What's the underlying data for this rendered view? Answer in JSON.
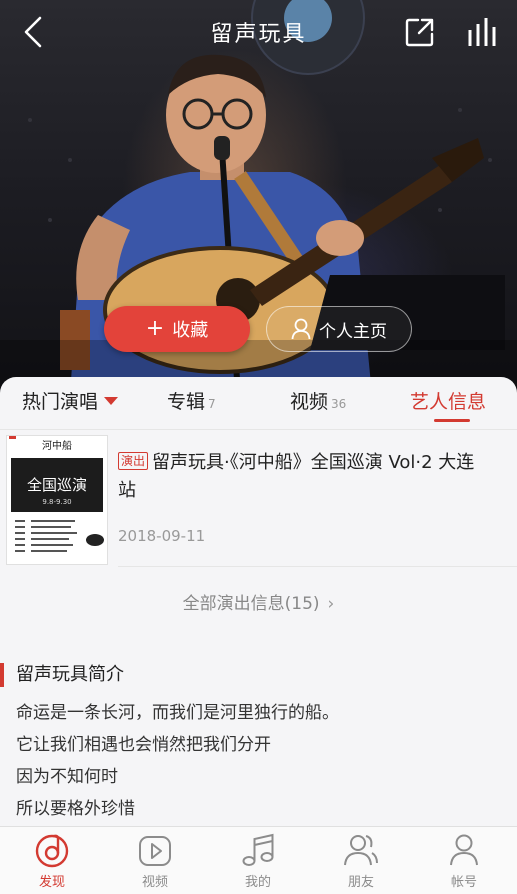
{
  "header": {
    "title": "留声玩具",
    "back_icon": "chevron-left-icon",
    "share_icon": "share-icon",
    "playing_icon": "now-playing-bars-icon"
  },
  "hero": {
    "collect_label": "收藏",
    "collect_icon": "plus-icon",
    "homepage_label": "个人主页",
    "homepage_icon": "user-icon"
  },
  "tabs": [
    {
      "label": "热门演唱",
      "count": ""
    },
    {
      "label": "专辑",
      "count": "7"
    },
    {
      "label": "视频",
      "count": "36"
    },
    {
      "label": "艺人信息",
      "count": ""
    }
  ],
  "concert": {
    "tag": "演出",
    "title": "留声玩具·《河中船》全国巡演 Vol·2 大连站",
    "date": "2018-09-11",
    "poster": {
      "heading": "河中船",
      "banner": "全国巡演",
      "sub": "9.8-9.30"
    }
  },
  "all_concerts": {
    "label": "全部演出信息(15)"
  },
  "intro": {
    "title": "留声玩具简介",
    "lines": [
      "命运是一条长河，而我们是河里独行的船。",
      "它让我们相遇也会悄然把我们分开",
      "因为不知何时",
      "所以要格外珍惜"
    ]
  },
  "bottom_nav": [
    {
      "label": "发现",
      "icon": "discover-icon",
      "active": true
    },
    {
      "label": "视频",
      "icon": "video-play-icon",
      "active": false
    },
    {
      "label": "我的",
      "icon": "music-note-icon",
      "active": false
    },
    {
      "label": "朋友",
      "icon": "friends-icon",
      "active": false
    },
    {
      "label": "帐号",
      "icon": "account-icon",
      "active": false
    }
  ],
  "colors": {
    "accent": "#d33a31",
    "collect_button": "#e3433a"
  }
}
